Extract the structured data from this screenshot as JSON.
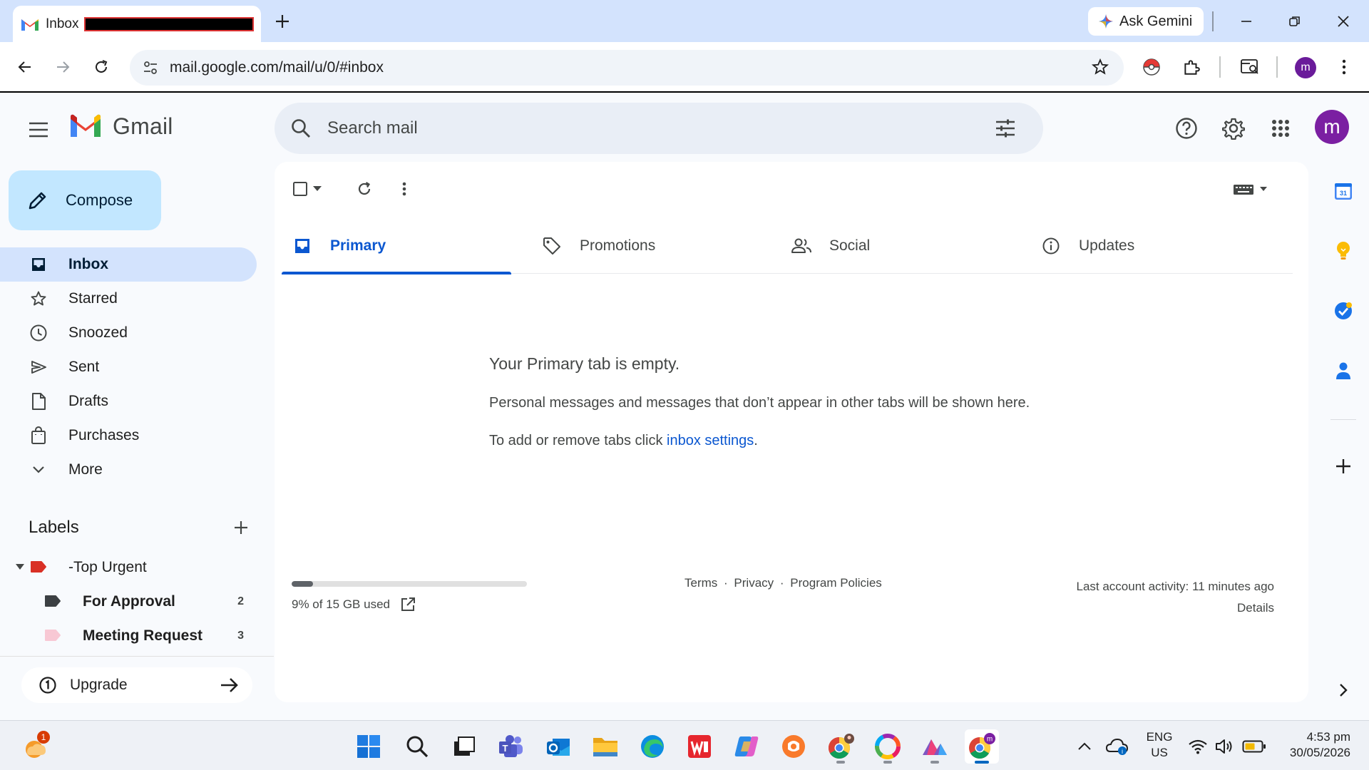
{
  "browser": {
    "tab_title": "Inbox",
    "new_tab_icon": "plus-icon",
    "gemini_label": "Ask Gemini",
    "url": "mail.google.com/mail/u/0/#inbox",
    "profile_initial": "m"
  },
  "gmail": {
    "wordmark": "Gmail",
    "search_placeholder": "Search mail",
    "avatar_initial": "m",
    "compose_label": "Compose",
    "nav": [
      {
        "label": "Inbox",
        "icon": "inbox-icon",
        "active": true
      },
      {
        "label": "Starred",
        "icon": "star-icon"
      },
      {
        "label": "Snoozed",
        "icon": "clock-icon"
      },
      {
        "label": "Sent",
        "icon": "send-icon"
      },
      {
        "label": "Drafts",
        "icon": "draft-icon"
      },
      {
        "label": "Purchases",
        "icon": "shopping-bag-icon"
      },
      {
        "label": "More",
        "icon": "chevron-down-icon"
      }
    ],
    "labels_heading": "Labels",
    "labels": [
      {
        "name": "-Top Urgent",
        "color": "#d93025",
        "count": ""
      },
      {
        "name": "For Approval",
        "color": "#3c4043",
        "count": "2"
      },
      {
        "name": "Meeting Request",
        "color": "#f8c8d4",
        "count": "3"
      }
    ],
    "upgrade_label": "Upgrade",
    "categories": [
      {
        "label": "Primary",
        "icon": "inbox-icon",
        "active": true
      },
      {
        "label": "Promotions",
        "icon": "tag-icon"
      },
      {
        "label": "Social",
        "icon": "people-icon"
      },
      {
        "label": "Updates",
        "icon": "info-icon"
      }
    ],
    "empty": {
      "title": "Your Primary tab is empty.",
      "line1": "Personal messages and messages that don’t appear in other tabs will be shown here.",
      "line2_prefix": "To add or remove tabs click ",
      "line2_link": "inbox settings",
      "line2_suffix": "."
    },
    "storage": {
      "text": "9% of 15 GB used",
      "fraction": 0.09
    },
    "footer": {
      "terms": "Terms",
      "privacy": "Privacy",
      "policies": "Program Policies",
      "sep": "·"
    },
    "activity": {
      "text": "Last account activity: 11 minutes ago",
      "details": "Details"
    }
  },
  "taskbar": {
    "weather_badge": "1",
    "lang_top": "ENG",
    "lang_bottom": "US",
    "time": "4:53 pm",
    "date": "30/05/2026"
  },
  "colors": {
    "accent": "#0b57d0",
    "compose_bg": "#c2e7ff",
    "active_nav_bg": "#d3e3fd",
    "avatar": "#7b1fa2"
  }
}
